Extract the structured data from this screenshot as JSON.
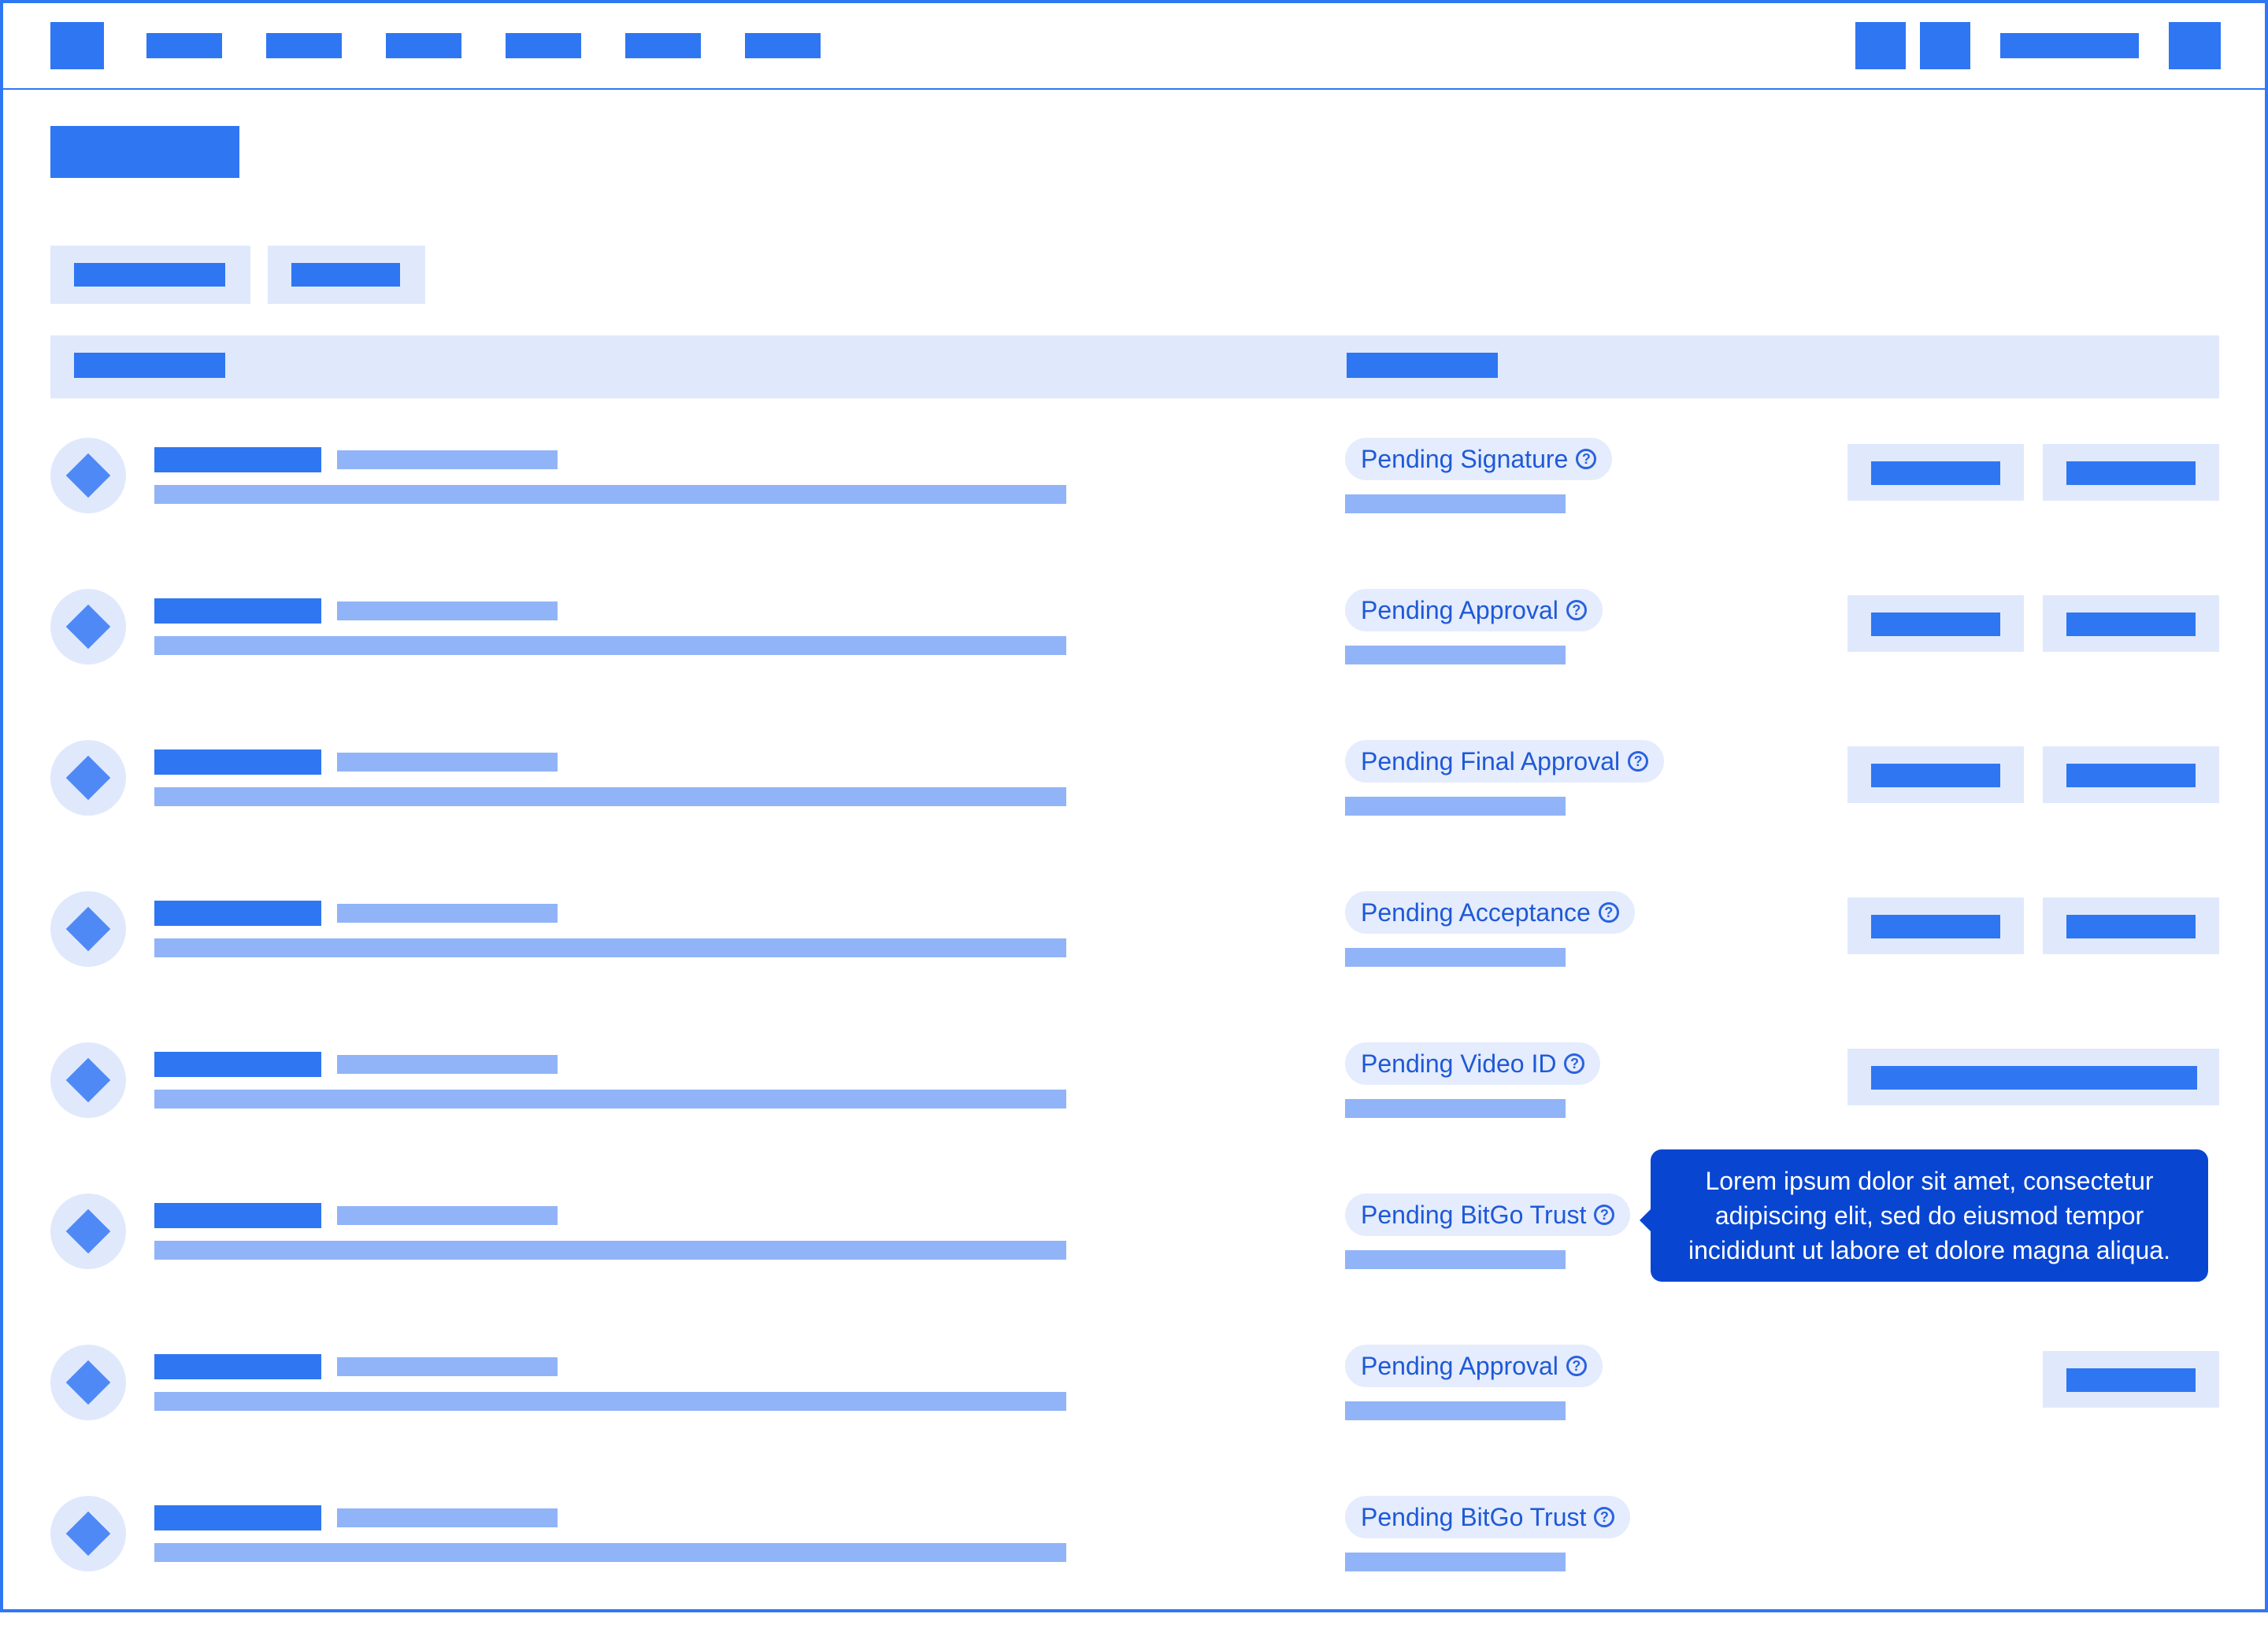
{
  "rows": [
    {
      "status": "Pending Signature"
    },
    {
      "status": "Pending Approval"
    },
    {
      "status": "Pending Final Approval"
    },
    {
      "status": "Pending Acceptance"
    },
    {
      "status": "Pending Video ID"
    },
    {
      "status": "Pending BitGo Trust"
    },
    {
      "status": "Pending Approval"
    },
    {
      "status": "Pending BitGo Trust"
    }
  ],
  "tooltip": {
    "text": "Lorem ipsum dolor sit amet, consectetur adipiscing elit, sed do eiusmod tempor incididunt ut labore et dolore magna aliqua."
  },
  "icons": {
    "row_icon": "diamond-icon",
    "status_help": "question-circle-icon",
    "logo": "logo-icon"
  },
  "colors": {
    "primary": "#2f76f2",
    "light": "#91b4f8",
    "pale": "#e0e9fc",
    "tooltip": "#0846d2",
    "status_text": "#1f59d6"
  }
}
